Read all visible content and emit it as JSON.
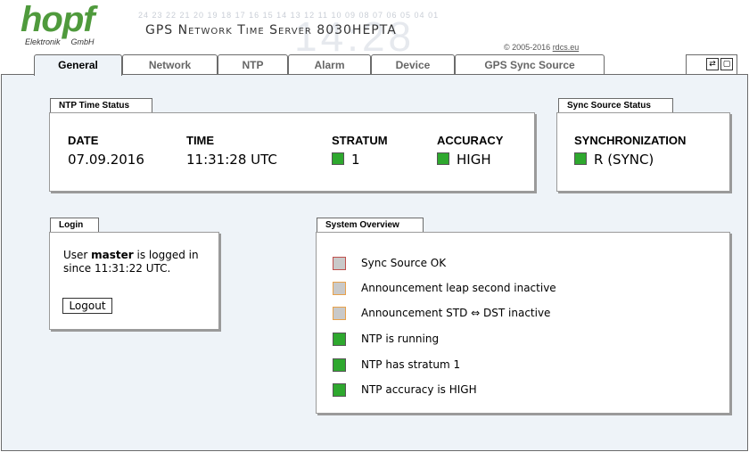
{
  "header": {
    "logo_main": "hopf",
    "logo_sub_left": "Elektronik",
    "logo_sub_right": "GmbH",
    "deco_numbers": "24 23 22 21 20 19 18 17 16 15 14 13 12 11 10 09 08 07 06 05 04 01",
    "deco_big": "14:28",
    "product_title": "GPS Network Time Server 8030HEPTA",
    "copyright_text": "© 2005-2016",
    "copyright_link": "rdcs.eu"
  },
  "tabs": [
    {
      "label": "General",
      "active": true
    },
    {
      "label": "Network",
      "active": false
    },
    {
      "label": "NTP",
      "active": false
    },
    {
      "label": "Alarm",
      "active": false
    },
    {
      "label": "Device",
      "active": false
    },
    {
      "label": "GPS Sync Source",
      "active": false
    }
  ],
  "tab_icons": {
    "refresh": "refresh-icon",
    "window": "window-icon",
    "refresh_glyph": "⇄",
    "window_glyph": "▢"
  },
  "ntp_status": {
    "title": "NTP Time Status",
    "date_label": "DATE",
    "date_value": "07.09.2016",
    "time_label": "TIME",
    "time_value": "11:31:28 UTC",
    "stratum_label": "STRATUM",
    "stratum_value": "1",
    "accuracy_label": "ACCURACY",
    "accuracy_value": "HIGH"
  },
  "sync_status": {
    "title": "Sync Source Status",
    "sync_label": "SYNCHRONIZATION",
    "sync_value": "R (SYNC)"
  },
  "login": {
    "title": "Login",
    "line1_prefix": "User ",
    "user": "master",
    "line1_suffix": " is logged in",
    "line2": "since 11:31:22 UTC.",
    "logout_label": "Logout"
  },
  "overview": {
    "title": "System Overview",
    "items": [
      {
        "label": "Sync Source OK",
        "state": "red"
      },
      {
        "label": "Announcement leap second inactive",
        "state": "orange"
      },
      {
        "label": "Announcement STD ⇔ DST inactive",
        "state": "orange"
      },
      {
        "label": "NTP is running",
        "state": "green"
      },
      {
        "label": "NTP has stratum 1",
        "state": "green"
      },
      {
        "label": "NTP accuracy is HIGH",
        "state": "green"
      }
    ]
  },
  "colors": {
    "status_green": "#2ea82e",
    "panel_bg": "#eef3f8",
    "logo_green": "#4f9a3c"
  }
}
